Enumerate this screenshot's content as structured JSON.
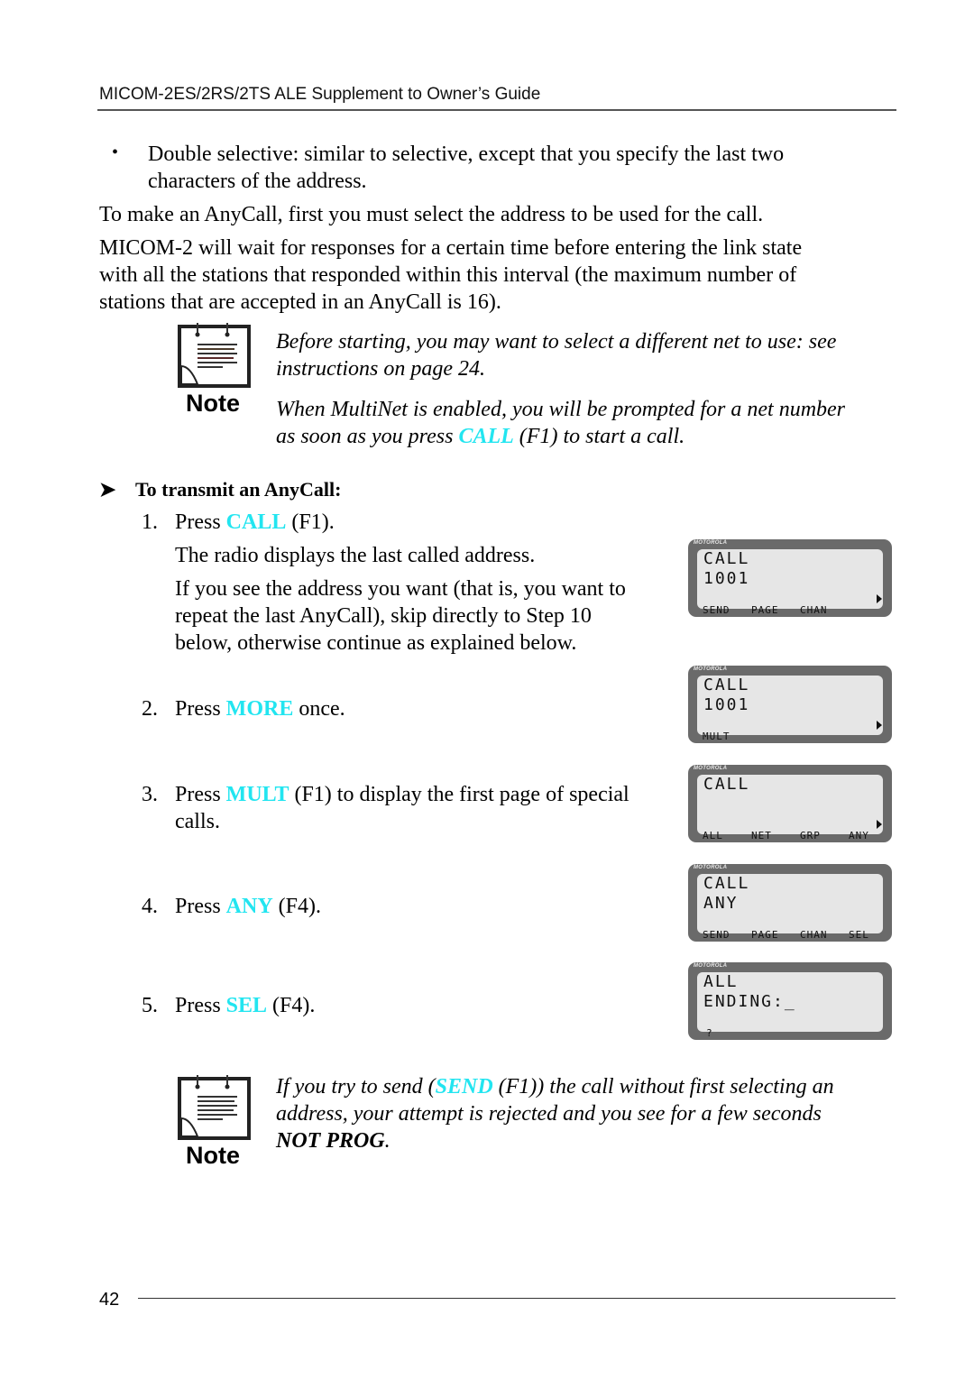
{
  "header": {
    "title": "MICOM-2ES/2RS/2TS ALE Supplement to Owner’s Guide"
  },
  "bullet": {
    "line1": "Double selective: similar to selective, except that you specify the last two",
    "line2": "characters of the address."
  },
  "paragraphs": {
    "p1": "To make an AnyCall, first you must select the address to be used for the call.",
    "p2_l1": "MICOM-2 will wait for responses for a certain time before entering the link state",
    "p2_l2": "with all the stations that responded within this interval (the maximum number of",
    "p2_l3": "stations that are accepted in an AnyCall is 16)."
  },
  "note1": {
    "label": "Note",
    "t1_l1": "Before starting, you may want to select a different net to use: see",
    "t1_l2": "instructions on page 24.",
    "t2_l1": "When MultiNet is enabled, you will be prompted for a net number",
    "t2_l2_pre": "as soon as you press ",
    "t2_l2_key": "CALL",
    "t2_l2_post": " (F1) to start a call."
  },
  "procedure": {
    "heading": "To transmit an AnyCall:",
    "steps": [
      {
        "num": "1.",
        "pre": "Press ",
        "key": "CALL",
        "post": " (F1).",
        "sub1": "The radio displays the last called address.",
        "sub2_l1": "If you see the address you want (that is, you want to",
        "sub2_l2": "repeat the last AnyCall), skip directly to Step 10",
        "sub2_l3": "below, otherwise continue as explained below."
      },
      {
        "num": "2.",
        "pre": "Press ",
        "key": "MORE",
        "post": " once."
      },
      {
        "num": "3.",
        "pre": "Press ",
        "key": "MULT",
        "post": " (F1) to display the first page of special",
        "cont": "calls."
      },
      {
        "num": "4.",
        "pre": "Press ",
        "key": "ANY",
        "post": " (F4)."
      },
      {
        "num": "5.",
        "pre": "Press ",
        "key": "SEL",
        "post": " (F4)."
      }
    ]
  },
  "displays": [
    {
      "brand": "MOTOROLA",
      "line1": "CALL",
      "line2": "1001",
      "softkeys": [
        "SEND",
        "PAGE",
        "CHAN",
        ""
      ],
      "more_arrow": true
    },
    {
      "brand": "MOTOROLA",
      "line1": "CALL",
      "line2": "1001",
      "softkeys": [
        "MULT",
        "",
        "",
        ""
      ],
      "more_arrow": true
    },
    {
      "brand": "MOTOROLA",
      "line1": "CALL",
      "line2": "",
      "softkeys": [
        "ALL",
        "NET",
        "GRP",
        "ANY"
      ],
      "more_arrow": true
    },
    {
      "brand": "MOTOROLA",
      "line1": "CALL",
      "line2": "ANY",
      "softkeys": [
        "SEND",
        "PAGE",
        "CHAN",
        "SEL"
      ],
      "more_arrow": false
    },
    {
      "brand": "MOTOROLA",
      "line1": "ALL",
      "line2": "ENDING:",
      "softkeys": [
        "?",
        "",
        "",
        ""
      ],
      "more_arrow": false,
      "cursor": "_"
    }
  ],
  "note2": {
    "label": "Note",
    "l1_pre": "If you try to send (",
    "l1_key": "SEND",
    "l1_post": " (F1)) the call without first selecting an",
    "l2": "address, your attempt is rejected and you see for a few seconds",
    "l3": "NOT PROG",
    "l3_post": "."
  },
  "footer": {
    "page_number": "42"
  },
  "colors": {
    "key_highlight": "#22e5f0",
    "lcd_bezel": "#6a6a6a",
    "lcd_screen": "#e6e6e6"
  }
}
